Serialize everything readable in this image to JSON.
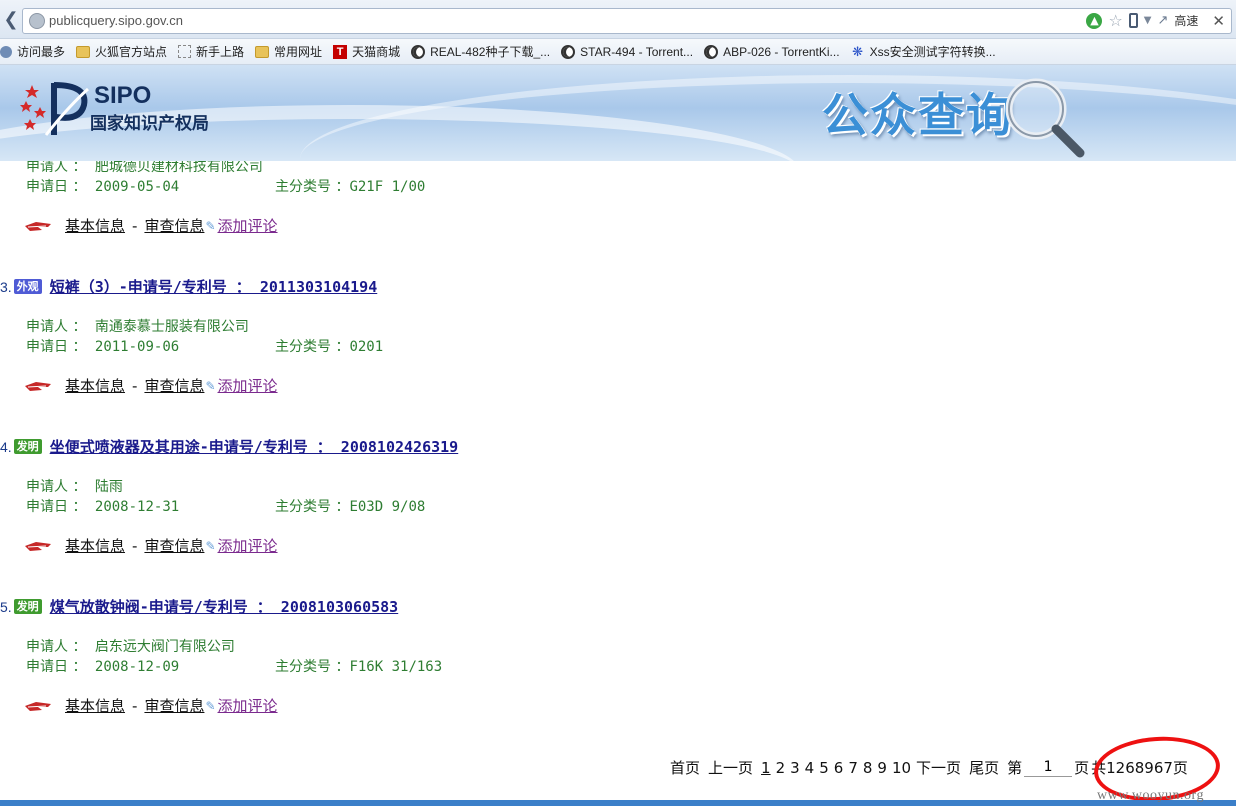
{
  "browser": {
    "url": "publicquery.sipo.gov.cn",
    "speed_label": "高速",
    "bookmarks": [
      {
        "label": "访问最多",
        "icon": "gear-icon"
      },
      {
        "label": "火狐官方站点",
        "icon": "folder-icon"
      },
      {
        "label": "新手上路",
        "icon": "blank-page-icon"
      },
      {
        "label": "常用网址",
        "icon": "folder-icon"
      },
      {
        "label": "天猫商城",
        "icon": "tmall-icon"
      },
      {
        "label": "REAL-482种子下载_...",
        "icon": "panda-icon"
      },
      {
        "label": "STAR-494 - Torrent...",
        "icon": "panda-icon"
      },
      {
        "label": "ABP-026 - TorrentKi...",
        "icon": "panda-icon"
      },
      {
        "label": "Xss安全测试字符转换...",
        "icon": "paw-icon"
      }
    ]
  },
  "banner": {
    "logo_en": "SIPO",
    "logo_cn": "国家知识产权局",
    "title": "公众查询"
  },
  "labels": {
    "applicant": "申请人 ：",
    "apply_date": "申请日 ：",
    "main_class": "主分类号 ：",
    "basic_info": "基本信息",
    "separator": "-",
    "exam_info": "审查信息",
    "add_comment": "添加评论"
  },
  "results": [
    {
      "applicant": "肥城德贝建材科技有限公司",
      "apply_date": "2009-05-04",
      "main_class": "G21F 1/00"
    },
    {
      "index": "3.",
      "tag": "外观",
      "tag_color": "#4f5bd5",
      "title": "短裤（3）-申请号/专利号 ： 2011303104194",
      "applicant": "南通泰慕士服装有限公司",
      "apply_date": "2011-09-06",
      "main_class": "0201"
    },
    {
      "index": "4.",
      "tag": "发明",
      "tag_color": "#3f9b2f",
      "title": "坐便式喷液器及其用途-申请号/专利号 ： 2008102426319",
      "applicant": "陆雨",
      "apply_date": "2008-12-31",
      "main_class": "E03D 9/08"
    },
    {
      "index": "5.",
      "tag": "发明",
      "tag_color": "#3f9b2f",
      "title": "煤气放散钟阀-申请号/专利号 ： 2008103060583",
      "applicant": "启东远大阀门有限公司",
      "apply_date": "2008-12-09",
      "main_class": "F16K 31/163"
    }
  ],
  "pager": {
    "first": "首页",
    "prev": "上一页",
    "pages": [
      "1",
      "2",
      "3",
      "4",
      "5",
      "6",
      "7",
      "8",
      "9",
      "10"
    ],
    "current": "1",
    "next": "下一页",
    "last": "尾页",
    "goto_prefix": "第",
    "goto_value": "1",
    "goto_suffix": "页",
    "total": "共1268967页"
  },
  "watermark": "www.wooyun.org"
}
